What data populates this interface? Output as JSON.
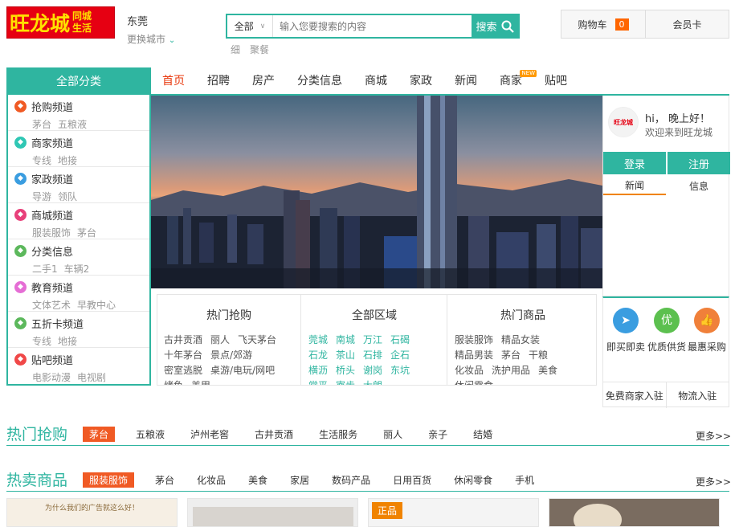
{
  "logo": {
    "main": "旺龙城",
    "sub1": "同城",
    "sub2": "生活"
  },
  "city": {
    "name": "东莞",
    "switch_label": "更换城市"
  },
  "search": {
    "scope": "全部",
    "placeholder": "输入您要搜索的内容",
    "button": "搜索"
  },
  "hot_keywords": [
    "细",
    "聚餐"
  ],
  "cart": {
    "label": "购物车",
    "count": "0"
  },
  "member": {
    "label": "会员卡"
  },
  "nav": {
    "all_categories": "全部分类",
    "items": [
      "首页",
      "招聘",
      "房产",
      "分类信息",
      "商城",
      "家政",
      "新闻",
      "商家",
      "贴吧"
    ],
    "new_badge": "NEW"
  },
  "categories": [
    {
      "title": "抢购频道",
      "links": [
        "茅台",
        "五粮液"
      ],
      "color": "#f05a24"
    },
    {
      "title": "商家频道",
      "links": [
        "专线",
        "地接"
      ],
      "color": "#2fc7b4"
    },
    {
      "title": "家政频道",
      "links": [
        "导游",
        "领队"
      ],
      "color": "#3a9de0"
    },
    {
      "title": "商城频道",
      "links": [
        "服装服饰",
        "茅台"
      ],
      "color": "#e8407a"
    },
    {
      "title": "分类信息",
      "links": [
        "二手1",
        "车辆2"
      ],
      "color": "#5cb85c"
    },
    {
      "title": "教育频道",
      "links": [
        "文体艺术",
        "早教中心"
      ],
      "color": "#e56ed5"
    },
    {
      "title": "五折卡频道",
      "links": [
        "专线",
        "地接"
      ],
      "color": "#5cb85c"
    },
    {
      "title": "贴吧频道",
      "links": [
        "电影动漫",
        "电视剧"
      ],
      "color": "#f04848"
    }
  ],
  "user_panel": {
    "avatar_text": "旺龙城",
    "greeting": "hi，  晚上好！",
    "welcome": "欢迎来到旺龙城",
    "login": "登录",
    "register": "注册",
    "tabs": [
      "新闻",
      "信息"
    ]
  },
  "hot_buy": {
    "title": "热门抢购",
    "items": [
      "古井贡酒",
      "丽人",
      "飞天茅台",
      "十年茅台",
      "景点/郊游",
      "密室逃脱",
      "桌游/电玩/网吧",
      "烤鱼",
      "美甲"
    ]
  },
  "regions": {
    "title": "全部区域",
    "items": [
      "莞城",
      "南城",
      "万江",
      "石碣",
      "石龙",
      "茶山",
      "石排",
      "企石",
      "横沥",
      "桥头",
      "谢岗",
      "东坑",
      "常平",
      "寮步",
      "大朗"
    ]
  },
  "hot_goods": {
    "title": "热门商品",
    "items": [
      "服装服饰",
      "精品女装",
      "精品男装",
      "茅台",
      "干粮",
      "化妆品",
      "洗护用品",
      "美食",
      "休闲零食"
    ]
  },
  "services": {
    "items": [
      {
        "label": "即买即卖",
        "icon": "paper-plane-icon",
        "glyph": "➤",
        "color": "#3a9de0"
      },
      {
        "label": "优质供货",
        "icon": "quality-icon",
        "glyph": "优",
        "color": "#5cc04f"
      },
      {
        "label": "最惠采购",
        "icon": "thumbs-up-icon",
        "glyph": "👍",
        "color": "#f0803a"
      }
    ],
    "footer": [
      "免费商家入驻",
      "物流入驻"
    ]
  },
  "section_hot": {
    "title": "热门抢购",
    "tags": [
      "茅台",
      "五粮液",
      "泸州老窖",
      "古井贡酒",
      "生活服务",
      "丽人",
      "亲子",
      "结婚"
    ],
    "more": "更多>>"
  },
  "section_sale": {
    "title": "热卖商品",
    "tags": [
      "服装服饰",
      "茅台",
      "化妆品",
      "美食",
      "家居",
      "数码产品",
      "日用百货",
      "休闲零食",
      "手机"
    ],
    "more": "更多>>"
  },
  "products": {
    "ad_text": "为什么我们的广告就这么好！",
    "badge": "正品"
  },
  "colors": {
    "accent": "#2fb5a0",
    "highlight": "#e8380d",
    "tag": "#f05a24"
  }
}
